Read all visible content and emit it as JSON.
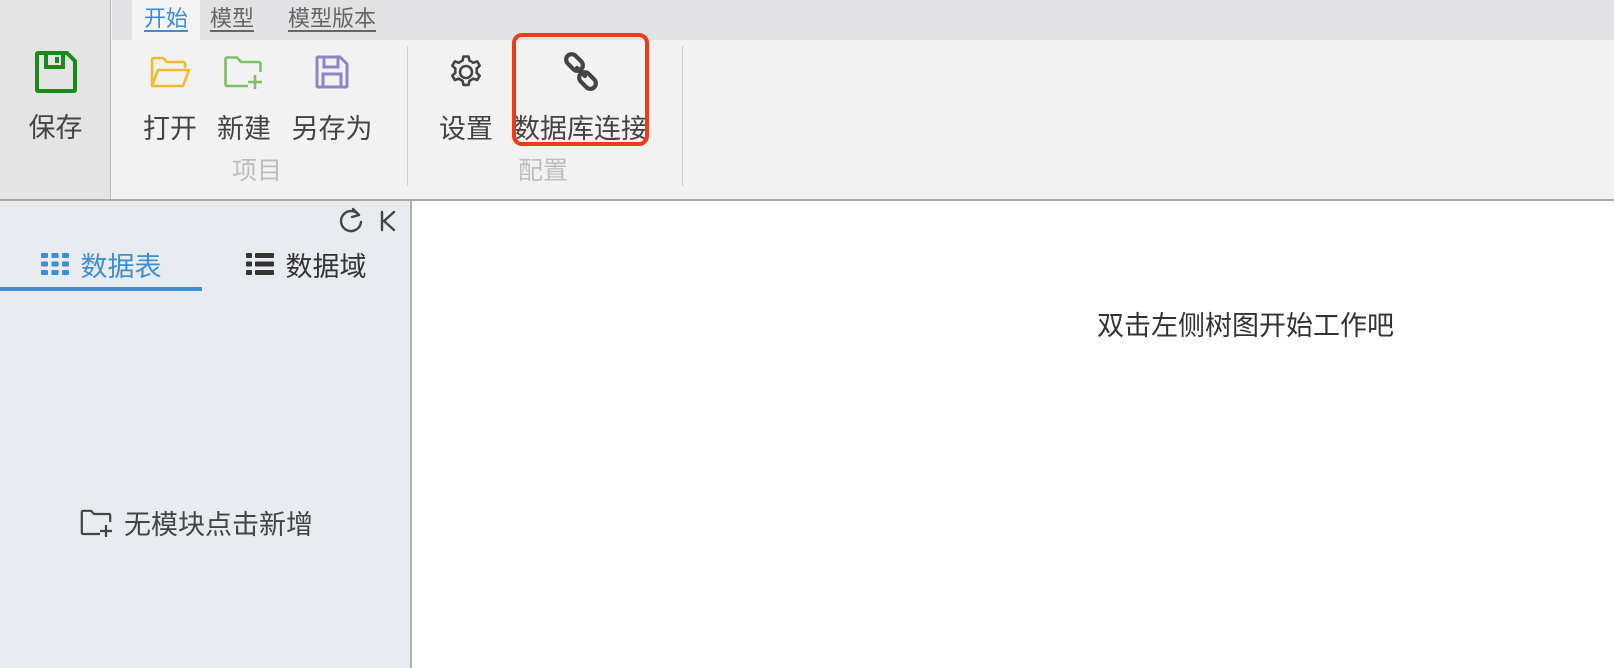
{
  "ribbon": {
    "save_label": "保存",
    "tabs": [
      {
        "label": "开始",
        "active": true
      },
      {
        "label": "模型",
        "active": false
      },
      {
        "label": "模型版本",
        "active": false
      }
    ],
    "groups": {
      "project": {
        "label": "项目",
        "buttons": {
          "open": "打开",
          "new": "新建",
          "save_as": "另存为"
        }
      },
      "config": {
        "label": "配置",
        "buttons": {
          "settings": "设置",
          "db_connect": "数据库连接"
        }
      }
    },
    "icons": {
      "save": "floppy-disk-icon",
      "open": "folder-open-icon",
      "new": "folder-plus-icon",
      "save_as": "floppy-disk-icon",
      "settings": "gear-icon",
      "db_connect": "link-icon"
    }
  },
  "sidebar": {
    "tabs": [
      {
        "label": "数据表",
        "active": true,
        "icon": "grid-icon"
      },
      {
        "label": "数据域",
        "active": false,
        "icon": "list-icon"
      }
    ],
    "tools": {
      "refresh": "refresh-icon",
      "collapse": "collapse-icon"
    },
    "empty_text": "无模块点击新增"
  },
  "main": {
    "hint": "双击左侧树图开始工作吧"
  },
  "colors": {
    "accent": "#3b8ed8",
    "save_icon": "#1a8a1a",
    "open_icon": "#f5b731",
    "new_icon": "#7cbf6a",
    "save_as_icon": "#8c84c8",
    "highlight": "#f23a15"
  }
}
